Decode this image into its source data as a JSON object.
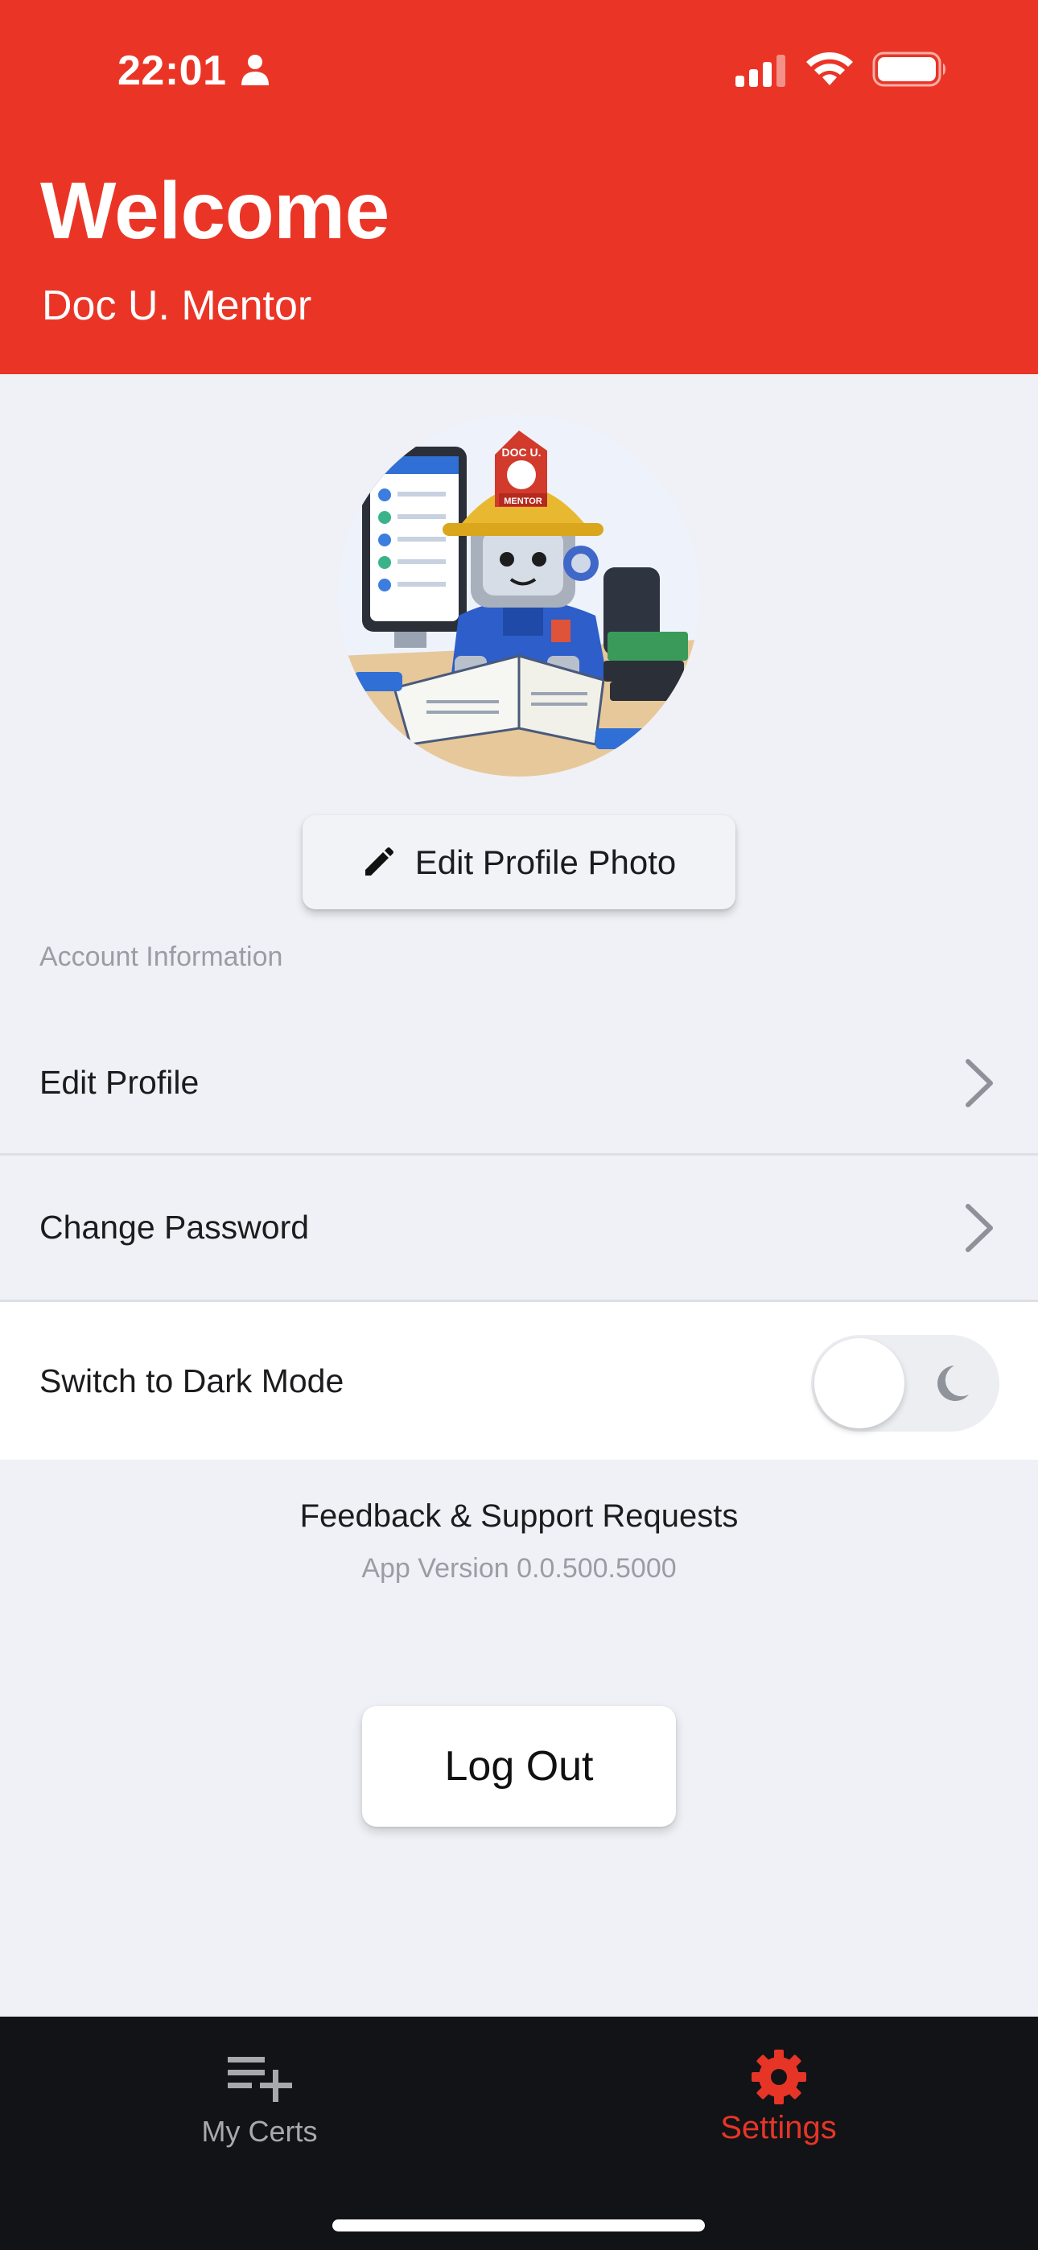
{
  "status_bar": {
    "time": "22:01",
    "icons": [
      "person-icon",
      "signal-icon",
      "wifi-icon",
      "battery-icon"
    ]
  },
  "header": {
    "title": "Welcome",
    "user_name": "Doc U. Mentor",
    "background_color": "#ea3526"
  },
  "profile": {
    "avatar_icon": "robot-firefighter-avatar",
    "avatar_lettering": [
      "DOC U.",
      "MENTOR"
    ],
    "edit_photo_label": "Edit Profile Photo",
    "edit_photo_icon": "pencil-icon"
  },
  "account": {
    "section_title": "Account Information",
    "items": [
      {
        "label": "Edit Profile",
        "icon": "chevron-right-icon"
      },
      {
        "label": "Change Password",
        "icon": "chevron-right-icon"
      }
    ],
    "dark_mode": {
      "label": "Switch to Dark Mode",
      "enabled": false,
      "icon": "moon-icon"
    }
  },
  "support": {
    "feedback_label": "Feedback & Support Requests",
    "version_text": "App Version 0.0.500.5000"
  },
  "logout_label": "Log Out",
  "tabbar": {
    "tabs": [
      {
        "label": "My Certs",
        "icon": "playlist-add-icon",
        "active": false
      },
      {
        "label": "Settings",
        "icon": "gear-icon",
        "active": true
      }
    ],
    "active_color": "#e63527",
    "inactive_color": "#a7a9af"
  }
}
